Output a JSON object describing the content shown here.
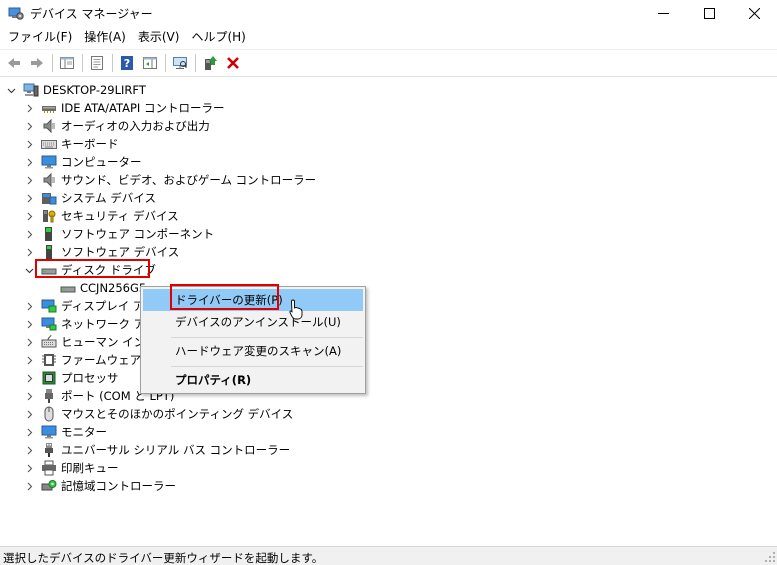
{
  "window": {
    "title": "デバイス マネージャー",
    "minimize_icon": "minimize-icon",
    "maximize_icon": "maximize-icon",
    "close_icon": "close-icon"
  },
  "menubar": {
    "items": [
      "ファイル(F)",
      "操作(A)",
      "表示(V)",
      "ヘルプ(H)"
    ]
  },
  "toolbar": {
    "icons": [
      "back-arrow-icon",
      "forward-arrow-icon",
      "console-tree-icon",
      "properties-icon",
      "help-icon",
      "action-pane-icon",
      "scan-hardware-icon",
      "update-driver-icon",
      "uninstall-device-icon"
    ]
  },
  "tree": {
    "root": "DESKTOP-29LIRFT",
    "categories": [
      {
        "label": "IDE ATA/ATAPI コントローラー",
        "icon": "ide-controller-icon"
      },
      {
        "label": "オーディオの入力および出力",
        "icon": "speaker-icon"
      },
      {
        "label": "キーボード",
        "icon": "keyboard-icon"
      },
      {
        "label": "コンピューター",
        "icon": "monitor-icon"
      },
      {
        "label": "サウンド、ビデオ、およびゲーム コントローラー",
        "icon": "speaker-icon"
      },
      {
        "label": "システム デバイス",
        "icon": "system-devices-icon"
      },
      {
        "label": "セキュリティ デバイス",
        "icon": "security-key-icon"
      },
      {
        "label": "ソフトウェア コンポーネント",
        "icon": "software-component-icon"
      },
      {
        "label": "ソフトウェア デバイス",
        "icon": "software-device-icon"
      },
      {
        "label": "ディスク ドライブ",
        "icon": "disk-drive-icon"
      },
      {
        "label": "CCJN256G5...",
        "icon": "disk-drive-icon"
      },
      {
        "label": "ディスプレイ アダプター",
        "icon": "display-adapter-icon"
      },
      {
        "label": "ネットワーク アダプター",
        "icon": "network-adapter-icon"
      },
      {
        "label": "ヒューマン インターフェイス デバイス",
        "icon": "hid-icon"
      },
      {
        "label": "ファームウェア",
        "icon": "firmware-icon"
      },
      {
        "label": "プロセッサ",
        "icon": "processor-icon"
      },
      {
        "label": "ポート (COM と LPT)",
        "icon": "port-icon"
      },
      {
        "label": "マウスとそのほかのポインティング デバイス",
        "icon": "mouse-icon"
      },
      {
        "label": "モニター",
        "icon": "monitor-icon"
      },
      {
        "label": "ユニバーサル シリアル バス コントローラー",
        "icon": "usb-icon"
      },
      {
        "label": "印刷キュー",
        "icon": "printer-icon"
      },
      {
        "label": "記憶域コントローラー",
        "icon": "storage-controller-icon"
      }
    ]
  },
  "context_menu": {
    "items": [
      {
        "label": "ドライバーの更新(P)"
      },
      {
        "label": "デバイスのアンインストール(U)"
      },
      {
        "label": "ハードウェア変更のスキャン(A)"
      },
      {
        "label": "プロパティ(R)"
      }
    ]
  },
  "statusbar": {
    "text": "選択したデバイスのドライバー更新ウィザードを起動します。"
  },
  "colors": {
    "highlight_box": "#e00000",
    "menu_hover": "#91c9f7",
    "uninstall_red": "#d00000"
  }
}
